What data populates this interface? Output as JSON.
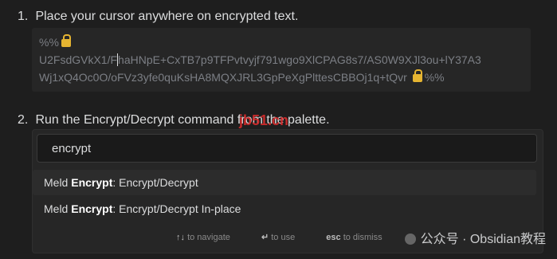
{
  "step1": {
    "num": "1.",
    "text": "Place your cursor anywhere on encrypted text."
  },
  "code": {
    "line1_prefix": "%%",
    "line2_a": "U2FsdGVkX1/F",
    "line2_b": "haHNpE+CxTB7p9TFPvtvyjf791wgo9XlCPAG8s7/AS0W9XJl3ou+lY37A3",
    "line3": "Wj1xQ4Oc0O/oFVz3yfe0quKsHA8MQXJRL3GpPeXgPlttesCBBOj1q+tQvr",
    "line3_suffix": "%%"
  },
  "step2": {
    "num": "2.",
    "text": "Run the Encrypt/Decrypt command from the palette."
  },
  "palette": {
    "search_value": "encrypt",
    "items": [
      {
        "pre": "Meld ",
        "bold": "Encrypt",
        "post": ": Encrypt/Decrypt"
      },
      {
        "pre": "Meld ",
        "bold": "Encrypt",
        "post": ": Encrypt/Decrypt In-place"
      }
    ],
    "hints": [
      {
        "key": "↑↓",
        "label": "to navigate"
      },
      {
        "key": "↵",
        "label": "to use"
      },
      {
        "key": "esc",
        "label": "to dismiss"
      }
    ]
  },
  "watermarks": {
    "red": "jb51.cn",
    "right": "公众号 · Obsidian教程"
  },
  "colors": {
    "lock": "#e5b431",
    "background": "#1e1e1e"
  }
}
